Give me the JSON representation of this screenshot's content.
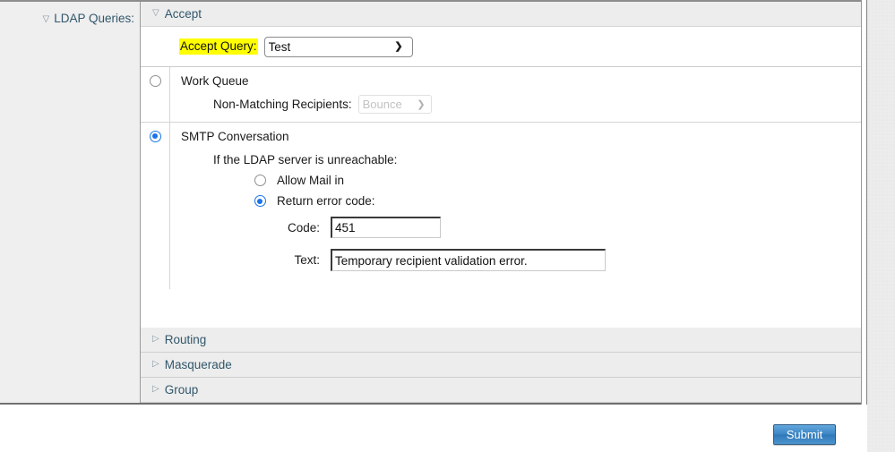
{
  "left_column": {
    "label": "LDAP Queries:",
    "disclosure": "expanded"
  },
  "sections": {
    "accept": {
      "title": "Accept",
      "disclosure": "expanded",
      "accept_query": {
        "label": "Accept Query:",
        "highlight_color": "#ffff00",
        "selected": "Test",
        "options": [
          "Test"
        ]
      },
      "work_queue": {
        "title": "Work Queue",
        "selected": false,
        "non_matching_recipients": {
          "label": "Non-Matching Recipients:",
          "selected": "Bounce",
          "options": [
            "Bounce"
          ],
          "disabled": true
        }
      },
      "smtp_conversation": {
        "title": "SMTP Conversation",
        "selected": true,
        "unreachable_heading": "If the LDAP server is unreachable:",
        "choices": [
          {
            "label": "Allow Mail in",
            "selected": false
          },
          {
            "label": "Return error code:",
            "selected": true
          }
        ],
        "code_field": {
          "label": "Code:",
          "value": "451"
        },
        "text_field": {
          "label": "Text:",
          "value": "Temporary recipient validation error."
        }
      }
    },
    "collapsed": [
      {
        "title": "Routing",
        "disclosure": "collapsed"
      },
      {
        "title": "Masquerade",
        "disclosure": "collapsed"
      },
      {
        "title": "Group",
        "disclosure": "collapsed"
      }
    ]
  },
  "footer": {
    "submit_label": "Submit"
  },
  "icons": {
    "triangle_expanded": "▽",
    "triangle_collapsed": "▷",
    "chevron_down": "⌄"
  },
  "colors": {
    "header_text": "#31576b",
    "accent_radio": "#1a73e8",
    "highlight": "#ffff00",
    "submit_blue": "#3d86c4"
  }
}
